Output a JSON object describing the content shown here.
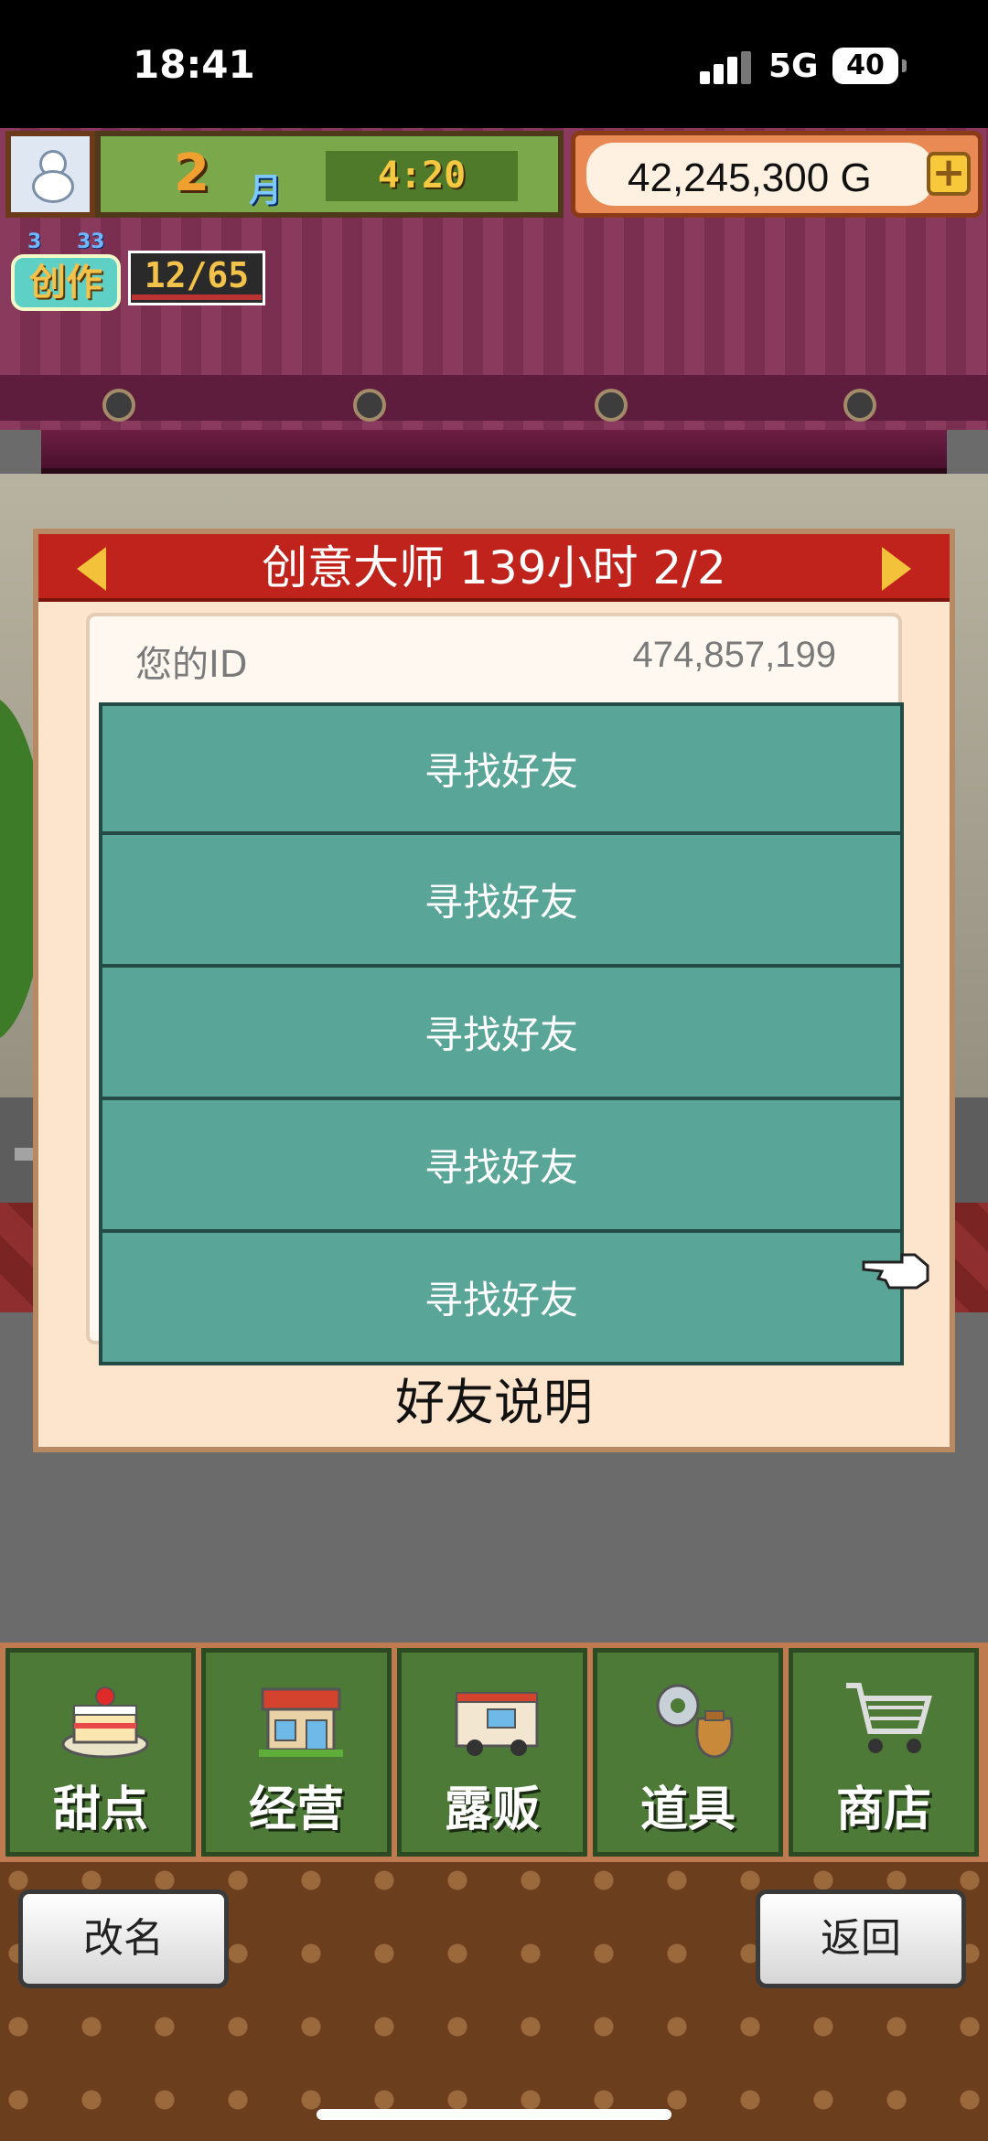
{
  "status_bar": {
    "time": "18:41",
    "network": "5G",
    "battery": "40"
  },
  "hud": {
    "month": "2",
    "month_unit": "月",
    "clock": "4:20",
    "money": "42,245,300 G",
    "add_symbol": "+",
    "badge_levels": [
      "3",
      "33"
    ],
    "badge_label": "创作",
    "badge_count": "12/65"
  },
  "modal": {
    "title": "创意大师  139小时 2/2",
    "id_label": "您的ID",
    "id_value": "474,857,199",
    "friend_slots": [
      "寻找好友",
      "寻找好友",
      "寻找好友",
      "寻找好友",
      "寻找好友"
    ],
    "footer": "好友说明"
  },
  "menu": [
    {
      "label": "甜点",
      "icon": "cake-icon"
    },
    {
      "label": "经营",
      "icon": "shop-icon"
    },
    {
      "label": "露贩",
      "icon": "food-truck-icon"
    },
    {
      "label": "道具",
      "icon": "gear-bag-icon"
    },
    {
      "label": "商店",
      "icon": "cart-icon"
    }
  ],
  "buttons": {
    "rename": "改名",
    "back": "返回"
  },
  "colors": {
    "header_red": "#c0231c",
    "slot_teal": "#59a597",
    "menu_green": "#4e7a38",
    "money_bg": "#e98a55"
  }
}
